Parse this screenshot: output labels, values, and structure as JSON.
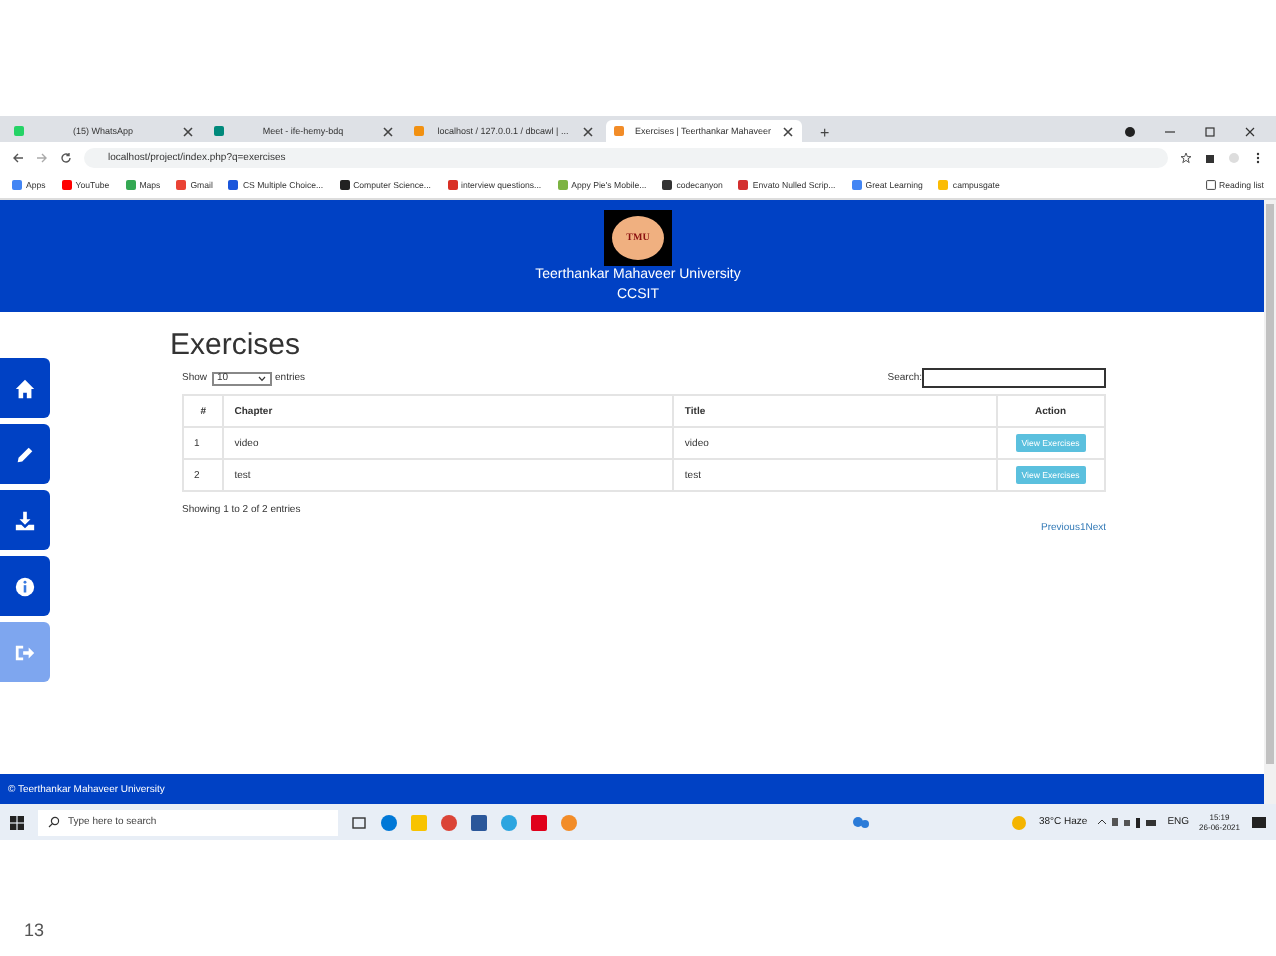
{
  "browser": {
    "tabs": [
      {
        "title": "(15) WhatsApp",
        "selected": false
      },
      {
        "title": "Meet - ife-hemy-bdq",
        "selected": false
      },
      {
        "title": "localhost / 127.0.0.1 / dbcawl | ...",
        "selected": false
      },
      {
        "title": "Exercises | Teerthankar Mahaveer",
        "selected": true
      }
    ],
    "new_tab": "+",
    "address": "localhost/project/index.php?q=exercises",
    "bookmarks": [
      "Apps",
      "YouTube",
      "Maps",
      "Gmail",
      "CS Multiple Choice...",
      "Computer Science...",
      "interview questions...",
      "Appy Pie's Mobile...",
      "codecanyon",
      "Envato Nulled Scrip...",
      "Great Learning",
      "campusgate"
    ],
    "reading_list": "Reading list"
  },
  "page": {
    "header": {
      "logo": "TMU",
      "university": "Teerthankar Mahaveer University",
      "department": "CCSIT"
    },
    "sidebar": [
      {
        "kind": "home"
      },
      {
        "kind": "edit"
      },
      {
        "kind": "download"
      },
      {
        "kind": "info"
      },
      {
        "kind": "logout"
      }
    ],
    "heading": "Exercises",
    "length_control": {
      "before": "Show",
      "value": "10",
      "after": "entries"
    },
    "search_label": "Search:",
    "table": {
      "columns": [
        "#",
        "Chapter",
        "Title",
        "Action"
      ],
      "rows": [
        {
          "cells": [
            "1",
            "video",
            "video"
          ],
          "action": "View Exercises"
        },
        {
          "cells": [
            "2",
            "test",
            "test"
          ],
          "action": "View Exercises"
        }
      ]
    },
    "info": "Showing 1 to 2 of 2 entries",
    "pagination": [
      "Previous",
      "1",
      "Next"
    ],
    "footer": "© Teerthankar Mahaveer University"
  },
  "taskbar": {
    "search_placeholder": "Type here to search",
    "weather": "38°C Haze",
    "language": "ENG",
    "time": "15:19",
    "date": "26-06-2021"
  },
  "slide_number": "13"
}
